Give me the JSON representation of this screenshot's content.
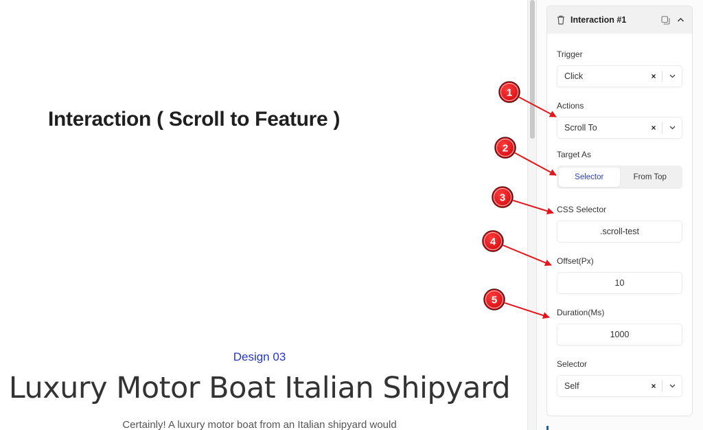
{
  "canvas": {
    "heading": "Interaction ( Scroll to Feature )",
    "section": {
      "eyebrow": "Design 03",
      "title": "Luxury Motor Boat Italian Shipyard",
      "body": "Certainly! A luxury motor boat from an Italian shipyard would"
    }
  },
  "panel": {
    "card_title": "Interaction #1",
    "icons": {
      "delete": "trash-icon",
      "duplicate": "duplicate-icon",
      "collapse": "chevron-up-icon"
    },
    "trigger": {
      "label": "Trigger",
      "value": "Click",
      "clear": "×"
    },
    "actions": {
      "label": "Actions",
      "value": "Scroll To",
      "clear": "×"
    },
    "target_as": {
      "label": "Target As",
      "options": [
        "Selector",
        "From Top"
      ],
      "selected": "Selector"
    },
    "css_selector": {
      "label": "CSS Selector",
      "value": ".scroll-test"
    },
    "offset": {
      "label": "Offset(Px)",
      "value": "10"
    },
    "duration": {
      "label": "Duration(Ms)",
      "value": "1000"
    },
    "selector": {
      "label": "Selector",
      "value": "Self",
      "clear": "×"
    }
  },
  "annotations": {
    "color": "#e3161d",
    "markers": [
      "1",
      "2",
      "3",
      "4",
      "5"
    ]
  }
}
